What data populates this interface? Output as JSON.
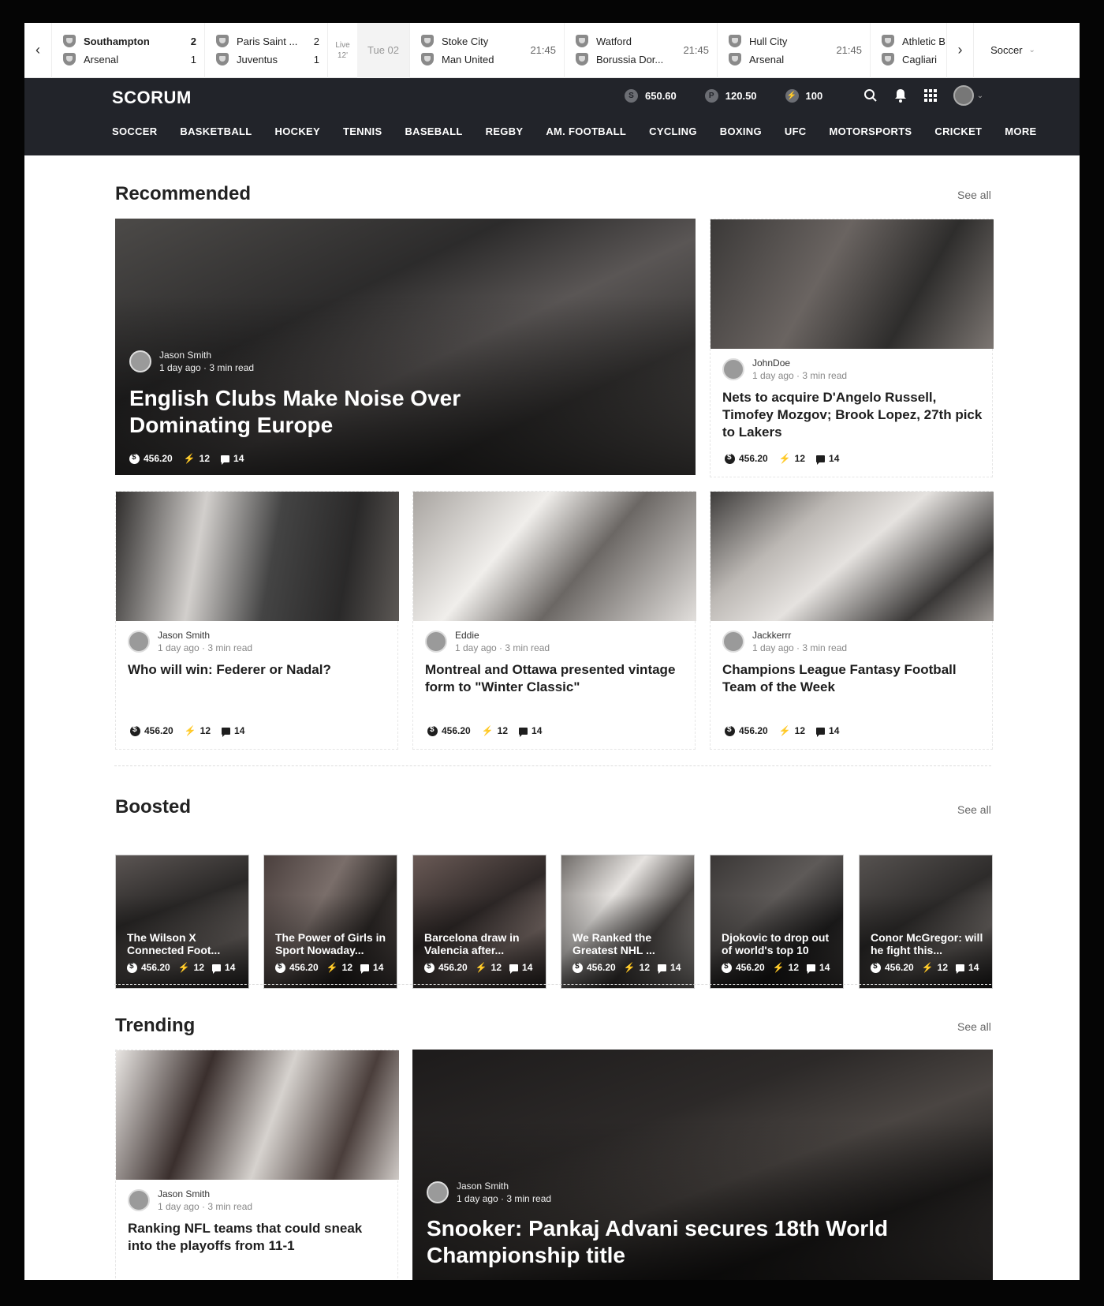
{
  "ticker": {
    "matches": [
      {
        "home": "Southampton",
        "away": "Arsenal",
        "home_score": "2",
        "away_score": "1"
      },
      {
        "home": "Paris Saint ...",
        "away": "Juventus",
        "home_score": "2",
        "away_score": "1",
        "status_line1": "Live",
        "status_line2": "12'"
      },
      {
        "home": "Stoke City",
        "away": "Man United",
        "time": "21:45"
      },
      {
        "home": "Watford",
        "away": "Borussia Dor...",
        "time": "21:45"
      },
      {
        "home": "Hull City",
        "away": "Arsenal",
        "time": "21:45"
      },
      {
        "home": "Athletic B",
        "away": "Cagliari"
      }
    ],
    "date": "Tue 02",
    "sport_select": "Soccer"
  },
  "header": {
    "logo": "SCORUM",
    "balances": [
      {
        "icon": "S",
        "value": "650.60"
      },
      {
        "icon": "P",
        "value": "120.50"
      },
      {
        "icon": "bolt",
        "value": "100"
      }
    ],
    "nav": [
      "SOCCER",
      "BASKETBALL",
      "HOCKEY",
      "TENNIS",
      "BASEBALL",
      "REGBY",
      "AM. FOOTBALL",
      "CYCLING",
      "BOXING",
      "UFC",
      "MOTORSPORTS",
      "CRICKET",
      "MORE"
    ]
  },
  "sections": {
    "recommended": "Recommended",
    "boosted": "Boosted",
    "trending": "Trending",
    "see_all": "See all"
  },
  "stats": {
    "amount": "456.20",
    "boosts": "12",
    "comments": "14"
  },
  "recommended": [
    {
      "author": "Jason Smith",
      "meta": "1 day ago · 3 min read",
      "title": "English Clubs Make Noise Over Dominating Europe"
    },
    {
      "author": "JohnDoe",
      "meta": "1 day ago · 3 min read",
      "title": "Nets to acquire D'Angelo Russell, Timofey Mozgov; Brook Lopez, 27th pick to Lakers"
    },
    {
      "author": "Jason Smith",
      "meta": "1 day ago · 3 min read",
      "title": "Who will win: Federer or Nadal?"
    },
    {
      "author": "Eddie",
      "meta": "1 day ago · 3 min read",
      "title": "Montreal and Ottawa presented vintage form to \"Winter Classic\""
    },
    {
      "author": "Jackkerrr",
      "meta": "1 day ago · 3 min read",
      "title": "Champions League Fantasy Football Team of the Week"
    }
  ],
  "boosted": [
    {
      "title": "The Wilson X Connected Foot..."
    },
    {
      "title": "The Power of Girls in Sport Nowaday..."
    },
    {
      "title": "Barcelona draw in Valencia after..."
    },
    {
      "title": "We Ranked the Greatest NHL ..."
    },
    {
      "title": "Djokovic to drop out of world's top 10"
    },
    {
      "title": "Conor McGregor: will he fight this..."
    }
  ],
  "trending": [
    {
      "author": "Jason Smith",
      "meta": "1 day ago · 3 min read",
      "title": "Ranking NFL teams that could sneak into the playoffs from 11-1"
    },
    {
      "author": "Jason Smith",
      "meta": "1 day ago · 3 min read",
      "title": "Snooker: Pankaj Advani secures 18th World Championship title"
    }
  ],
  "colors": {
    "header_bg": "#22242a",
    "page_bg": "#ffffff",
    "outer_bg": "#050505"
  }
}
